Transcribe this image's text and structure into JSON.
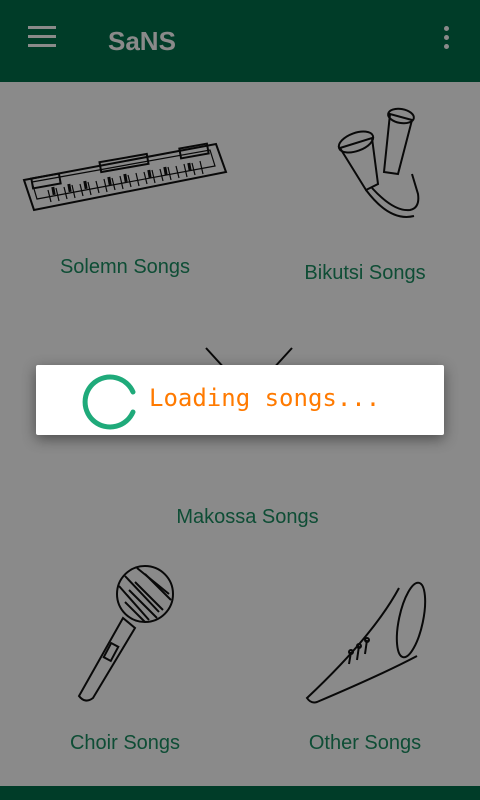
{
  "app": {
    "title": "SaNS"
  },
  "header": {
    "menu_icon": "hamburger-menu-icon",
    "overflow_icon": "more-vert-icon"
  },
  "categories": [
    {
      "label": "Solemn Songs",
      "icon": "keyboard-icon"
    },
    {
      "label": "Bikutsi Songs",
      "icon": "maracas-icon"
    },
    {
      "label": "Makossa Songs",
      "icon": "drum-icon"
    },
    {
      "label": "Choir Songs",
      "icon": "microphone-icon"
    },
    {
      "label": "Other Songs",
      "icon": "horn-icon"
    }
  ],
  "dialog": {
    "message": "Loading songs..."
  },
  "colors": {
    "primary": "#00704a",
    "label": "#1b8f63",
    "spinner": "#1faa7a",
    "loading_text": "#ff7a00"
  }
}
